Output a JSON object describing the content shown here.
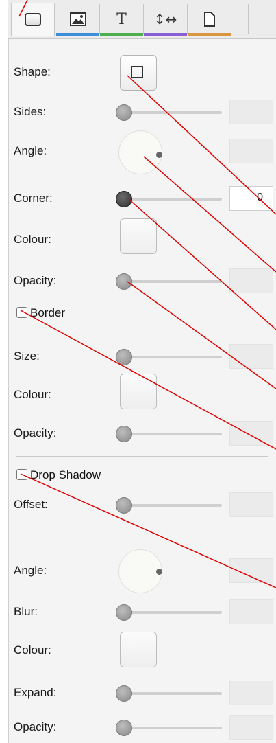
{
  "tabs": [
    {
      "name": "shape",
      "icon": "rounded-square-icon",
      "color": "#e6e6e6",
      "active": true
    },
    {
      "name": "image",
      "icon": "image-icon",
      "color": "#3b8fd9"
    },
    {
      "name": "text",
      "icon": "text-icon",
      "glyph": "T",
      "color": "#4cae4c"
    },
    {
      "name": "size",
      "icon": "resize-arrows-icon",
      "glyph": "↕↔",
      "color": "#8a5fd6"
    },
    {
      "name": "page",
      "icon": "page-icon",
      "color": "#d99540"
    }
  ],
  "shape_section": {
    "shape_label": "Shape:",
    "sides_label": "Sides:",
    "angle_label": "Angle:",
    "corner_label": "Corner:",
    "corner_value": "0",
    "colour_label": "Colour:",
    "opacity_label": "Opacity:"
  },
  "border_section": {
    "title": "Border",
    "size_label": "Size:",
    "colour_label": "Colour:",
    "opacity_label": "Opacity:"
  },
  "shadow_section": {
    "title": "Drop Shadow",
    "offset_label": "Offset:",
    "angle_label": "Angle:",
    "blur_label": "Blur:",
    "colour_label": "Colour:",
    "expand_label": "Expand:",
    "opacity_label": "Opacity:"
  },
  "annotation_color": "#e00000"
}
